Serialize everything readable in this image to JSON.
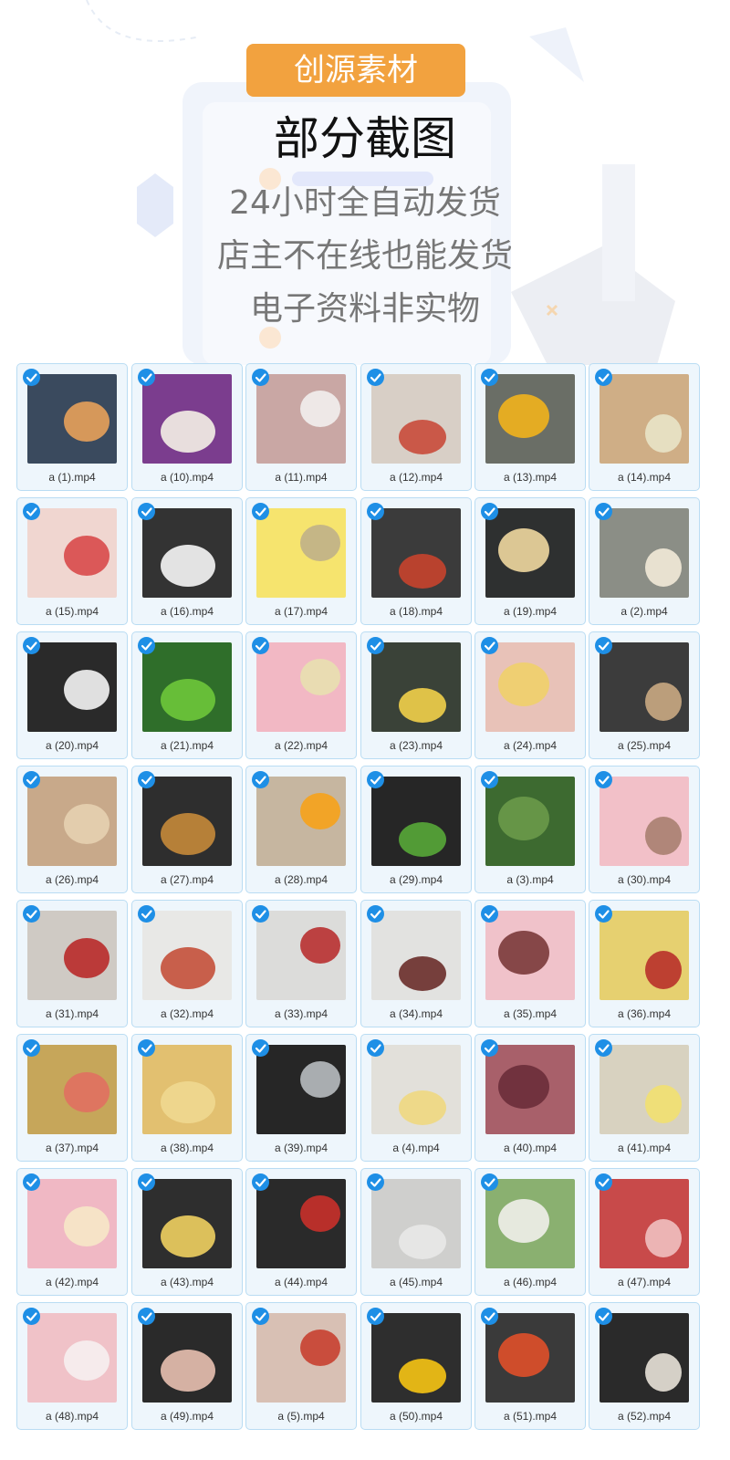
{
  "header": {
    "badge": "创源素材",
    "title": "部分截图",
    "lines": [
      "24小时全自动发货",
      "店主不在线也能发货",
      "电子资料非实物"
    ]
  },
  "colors": {
    "badge": "#f2a23f",
    "check": "#1e8fe6",
    "tile_border": "#b9dcf3",
    "tile_bg": "#eef6fc"
  },
  "icons": {
    "check": "checkmark-icon"
  },
  "files": [
    {
      "name": "a (1).mp4",
      "base": "#3a4a5e",
      "accent": "#e8a15a"
    },
    {
      "name": "a (10).mp4",
      "base": "#7b3d8e",
      "accent": "#f4f0e6"
    },
    {
      "name": "a (11).mp4",
      "base": "#c9a7a4",
      "accent": "#f2f0ee"
    },
    {
      "name": "a (12).mp4",
      "base": "#d8cfc6",
      "accent": "#c94a3a"
    },
    {
      "name": "a (13).mp4",
      "base": "#6a6e66",
      "accent": "#f2b21c"
    },
    {
      "name": "a (14).mp4",
      "base": "#cfae86",
      "accent": "#e8e4c8"
    },
    {
      "name": "a (15).mp4",
      "base": "#f0d6d0",
      "accent": "#d84a4a"
    },
    {
      "name": "a (16).mp4",
      "base": "#333333",
      "accent": "#f6f6f6"
    },
    {
      "name": "a (17).mp4",
      "base": "#f6e46e",
      "accent": "#c0b088"
    },
    {
      "name": "a (18).mp4",
      "base": "#3b3b3b",
      "accent": "#c8442e"
    },
    {
      "name": "a (19).mp4",
      "base": "#2e3030",
      "accent": "#f0d8a0"
    },
    {
      "name": "a (2).mp4",
      "base": "#8b8e86",
      "accent": "#f2ead8"
    },
    {
      "name": "a (20).mp4",
      "base": "#2a2a2a",
      "accent": "#f4f4f4"
    },
    {
      "name": "a (21).mp4",
      "base": "#2f6e2a",
      "accent": "#6ec63a"
    },
    {
      "name": "a (22).mp4",
      "base": "#f2b8c4",
      "accent": "#e8e0b0"
    },
    {
      "name": "a (23).mp4",
      "base": "#3a4238",
      "accent": "#f2d04a"
    },
    {
      "name": "a (24).mp4",
      "base": "#e8c2b8",
      "accent": "#f0d06a"
    },
    {
      "name": "a (25).mp4",
      "base": "#3c3c3c",
      "accent": "#c9a882"
    },
    {
      "name": "a (26).mp4",
      "base": "#c8a98a",
      "accent": "#e6d0b0"
    },
    {
      "name": "a (27).mp4",
      "base": "#2e2e2e",
      "accent": "#c58a3a"
    },
    {
      "name": "a (28).mp4",
      "base": "#c6b6a0",
      "accent": "#f6a21a"
    },
    {
      "name": "a (29).mp4",
      "base": "#262626",
      "accent": "#58a838"
    },
    {
      "name": "a (3).mp4",
      "base": "#3d6a30",
      "accent": "#6a9a4a"
    },
    {
      "name": "a (30).mp4",
      "base": "#f2c0c8",
      "accent": "#a88070"
    },
    {
      "name": "a (31).mp4",
      "base": "#cfcac4",
      "accent": "#b82a2a"
    },
    {
      "name": "a (32).mp4",
      "base": "#e8e8e6",
      "accent": "#c4503a"
    },
    {
      "name": "a (33).mp4",
      "base": "#dcdcda",
      "accent": "#b83030"
    },
    {
      "name": "a (34).mp4",
      "base": "#e2e2e0",
      "accent": "#6a2e2a"
    },
    {
      "name": "a (35).mp4",
      "base": "#f0c2ca",
      "accent": "#7a3a3a"
    },
    {
      "name": "a (36).mp4",
      "base": "#e6d070",
      "accent": "#b8302a"
    },
    {
      "name": "a (37).mp4",
      "base": "#c6a65a",
      "accent": "#e07060"
    },
    {
      "name": "a (38).mp4",
      "base": "#e2c070",
      "accent": "#f0d890"
    },
    {
      "name": "a (39).mp4",
      "base": "#262626",
      "accent": "#b8bcc0"
    },
    {
      "name": "a (4).mp4",
      "base": "#e2e0da",
      "accent": "#f0d880"
    },
    {
      "name": "a (40).mp4",
      "base": "#a8606a",
      "accent": "#6a2e3a"
    },
    {
      "name": "a (41).mp4",
      "base": "#d8d2c0",
      "accent": "#f2e070"
    },
    {
      "name": "a (42).mp4",
      "base": "#f0b8c4",
      "accent": "#f6e8c8"
    },
    {
      "name": "a (43).mp4",
      "base": "#2e2e2e",
      "accent": "#f0d060"
    },
    {
      "name": "a (44).mp4",
      "base": "#2a2a2a",
      "accent": "#c8302a"
    },
    {
      "name": "a (45).mp4",
      "base": "#cfcfcd",
      "accent": "#e8e8e8"
    },
    {
      "name": "a (46).mp4",
      "base": "#8ab070",
      "accent": "#f0f0ea"
    },
    {
      "name": "a (47).mp4",
      "base": "#c84a4a",
      "accent": "#f0c0c0"
    },
    {
      "name": "a (48).mp4",
      "base": "#f0c2c8",
      "accent": "#f6f0f0"
    },
    {
      "name": "a (49).mp4",
      "base": "#2a2a2a",
      "accent": "#e8c0b0"
    },
    {
      "name": "a (5).mp4",
      "base": "#d8c0b4",
      "accent": "#c84030"
    },
    {
      "name": "a (50).mp4",
      "base": "#2e2e2e",
      "accent": "#f6c414"
    },
    {
      "name": "a (51).mp4",
      "base": "#3a3a3a",
      "accent": "#e0502a"
    },
    {
      "name": "a (52).mp4",
      "base": "#2a2a2a",
      "accent": "#e8e2d8"
    }
  ]
}
